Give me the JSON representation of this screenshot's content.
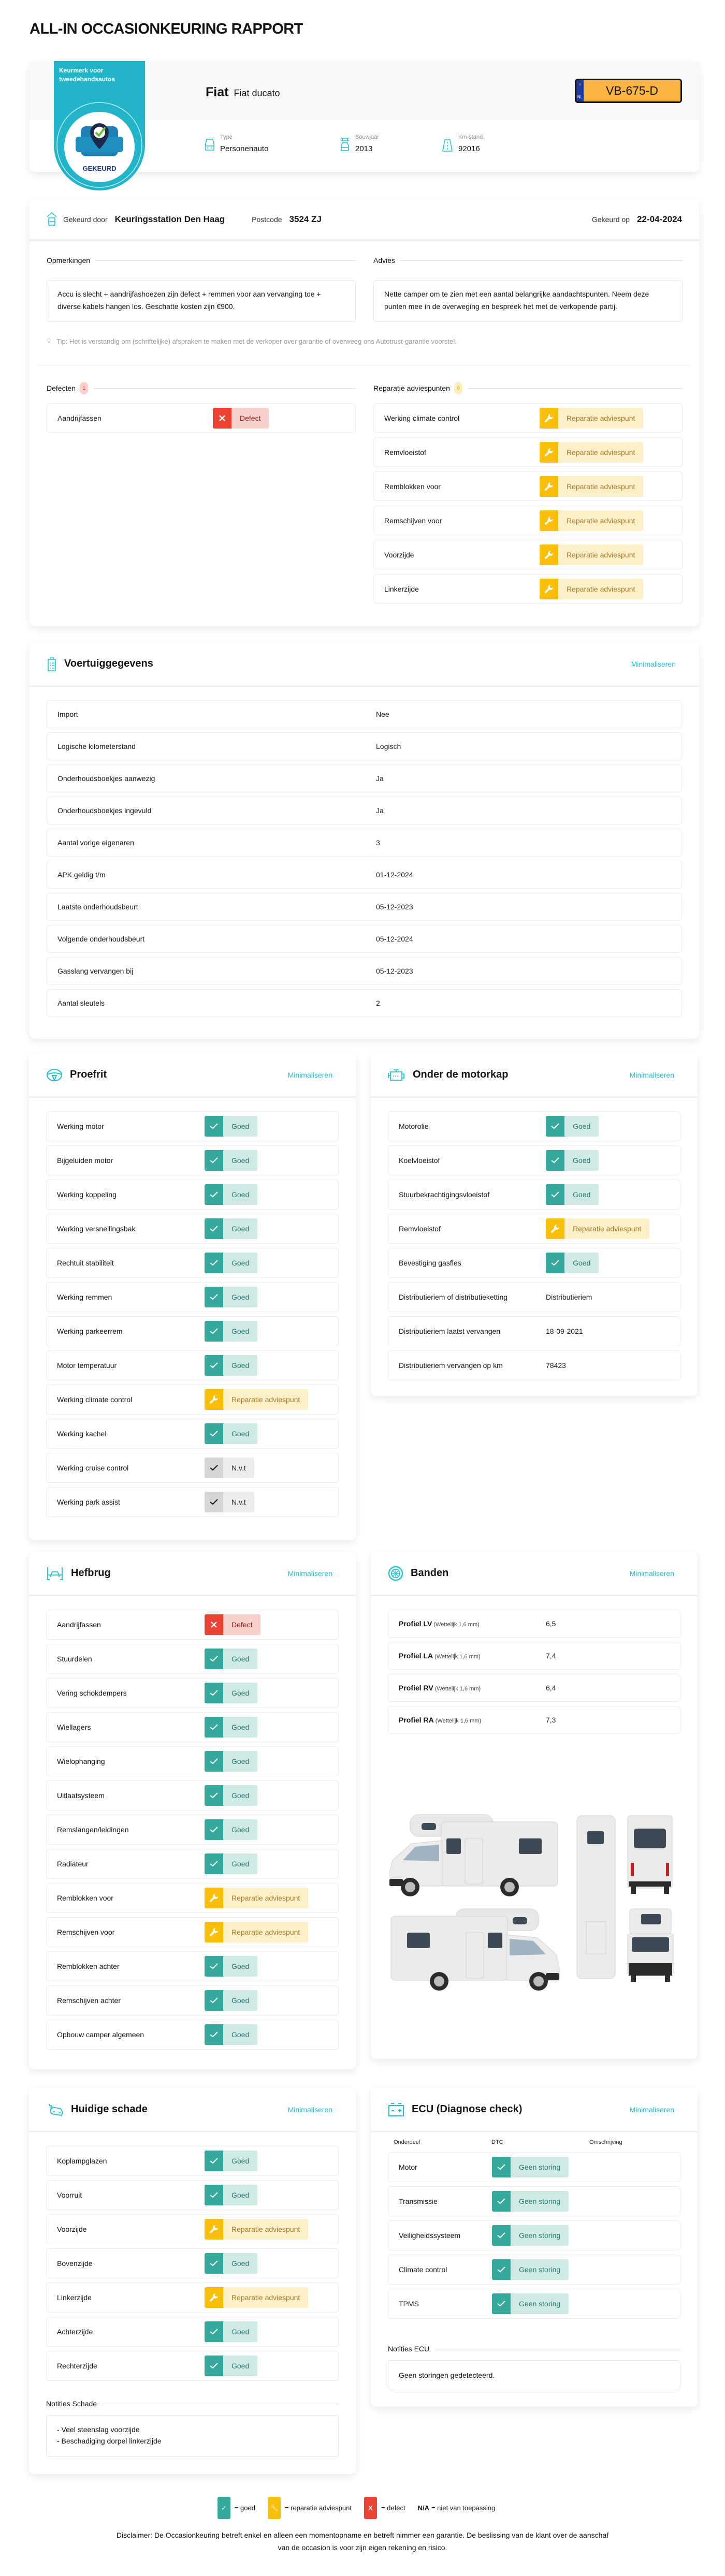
{
  "page_title": "ALL-IN OCCASIONKEURING RAPPORT",
  "colors": {
    "accent": "#1fc0d6",
    "goed": "#35a99b",
    "reparatie": "#f9bf0b",
    "defect": "#ea4335",
    "nvt": "#d6d6d6",
    "plate": "#fbb540"
  },
  "badge_logo": {
    "text_top": "Keurmerk voor tweedehandsautos",
    "text_bottom": "GEKEURD"
  },
  "vehicle_header": {
    "brand": "Fiat",
    "model": "Fiat ducato",
    "plate": {
      "country": "NL",
      "number": "VB-675-D"
    },
    "details": [
      {
        "label": "Type",
        "value": "Personenauto",
        "icon": "car-front-icon"
      },
      {
        "label": "Bouwjaar",
        "value": "2013",
        "icon": "car-lift-icon"
      },
      {
        "label": "Km-stand",
        "value": "92016",
        "icon": "road-icon"
      }
    ]
  },
  "inspection": {
    "by_label": "Gekeurd door",
    "by_value": "Keuringsstation Den Haag",
    "postcode_label": "Postcode",
    "postcode_value": "3524 ZJ",
    "date_label": "Gekeurd op",
    "date_value": "22-04-2024",
    "remarks_title": "Opmerkingen",
    "remarks": "Accu is slecht + aandrijfashoezen zijn defect + remmen voor aan vervanging toe + diverse kabels hangen los. Geschatte kosten zijn €900.",
    "advice_title": "Advies",
    "advice": "Nette camper om te zien met een aantal belangrijke aandachtspunten. Neem deze punten mee in de overweging en bespreek het met de verkopende partij.",
    "tip": "Tip: Het is verstandig om (schriftelijke) afspraken te maken met de verkoper over garantie of overweeg ons Autotrust-garantie voorstel.",
    "defects_title": "Defecten",
    "defects_count": "1",
    "defects": [
      {
        "label": "Aandrijfassen",
        "type": "def",
        "status": "Defect"
      }
    ],
    "repairs_title": "Reparatie adviespunten",
    "repairs_count": "6",
    "repairs": [
      {
        "label": "Werking climate control",
        "type": "rep",
        "status": "Reparatie adviespunt"
      },
      {
        "label": "Remvloeistof",
        "type": "rep",
        "status": "Reparatie adviespunt"
      },
      {
        "label": "Remblokken voor",
        "type": "rep",
        "status": "Reparatie adviespunt"
      },
      {
        "label": "Remschijven voor",
        "type": "rep",
        "status": "Reparatie adviespunt"
      },
      {
        "label": "Voorzijde",
        "type": "rep",
        "status": "Reparatie adviespunt"
      },
      {
        "label": "Linkerzijde",
        "type": "rep",
        "status": "Reparatie adviespunt"
      }
    ]
  },
  "minimize_label": "Minimaliseren",
  "vehicle_data": {
    "title": "Voertuiggegevens",
    "rows": [
      {
        "label": "Import",
        "value": "Nee"
      },
      {
        "label": "Logische kilometerstand",
        "value": "Logisch"
      },
      {
        "label": "Onderhoudsboekjes aanwezig",
        "value": "Ja"
      },
      {
        "label": "Onderhoudsboekjes ingevuld",
        "value": "Ja"
      },
      {
        "label": "Aantal vorige eigenaren",
        "value": "3"
      },
      {
        "label": "APK geldig t/m",
        "value": "01-12-2024"
      },
      {
        "label": "Laatste onderhoudsbeurt",
        "value": "05-12-2023"
      },
      {
        "label": "Volgende onderhoudsbeurt",
        "value": "05-12-2024"
      },
      {
        "label": "Gasslang vervangen bij",
        "value": "05-12-2023"
      },
      {
        "label": "Aantal sleutels",
        "value": "2"
      }
    ]
  },
  "proefrit": {
    "title": "Proefrit",
    "rows": [
      {
        "label": "Werking motor",
        "type": "goed",
        "status": "Goed"
      },
      {
        "label": "Bijgeluiden motor",
        "type": "goed",
        "status": "Goed"
      },
      {
        "label": "Werking koppeling",
        "type": "goed",
        "status": "Goed"
      },
      {
        "label": "Werking versnellingsbak",
        "type": "goed",
        "status": "Goed"
      },
      {
        "label": "Rechtuit stabiliteit",
        "type": "goed",
        "status": "Goed"
      },
      {
        "label": "Werking remmen",
        "type": "goed",
        "status": "Goed"
      },
      {
        "label": "Werking parkeerrem",
        "type": "goed",
        "status": "Goed"
      },
      {
        "label": "Motor temperatuur",
        "type": "goed",
        "status": "Goed"
      },
      {
        "label": "Werking climate control",
        "type": "rep",
        "status": "Reparatie adviespunt"
      },
      {
        "label": "Werking kachel",
        "type": "goed",
        "status": "Goed"
      },
      {
        "label": "Werking cruise control",
        "type": "nvt",
        "status": "N.v.t"
      },
      {
        "label": "Werking park assist",
        "type": "nvt",
        "status": "N.v.t"
      }
    ]
  },
  "motorkap": {
    "title": "Onder de motorkap",
    "rows": [
      {
        "label": "Motorolie",
        "type": "goed",
        "status": "Goed"
      },
      {
        "label": "Koelvloeistof",
        "type": "goed",
        "status": "Goed"
      },
      {
        "label": "Stuurbekrachtigingsvloeistof",
        "type": "goed",
        "status": "Goed"
      },
      {
        "label": "Remvloeistof",
        "type": "rep",
        "status": "Reparatie adviespunt"
      },
      {
        "label": "Bevestiging gasfles",
        "type": "goed",
        "status": "Goed"
      },
      {
        "label": "Distributieriem of distributieketting",
        "value": "Distributieriem"
      },
      {
        "label": "Distributieriem laatst vervangen",
        "value": "18-09-2021"
      },
      {
        "label": "Distributieriem vervangen op km",
        "value": "78423"
      }
    ]
  },
  "hefbrug": {
    "title": "Hefbrug",
    "rows": [
      {
        "label": "Aandrijfassen",
        "type": "def",
        "status": "Defect"
      },
      {
        "label": "Stuurdelen",
        "type": "goed",
        "status": "Goed"
      },
      {
        "label": "Vering schokdempers",
        "type": "goed",
        "status": "Goed"
      },
      {
        "label": "Wiellagers",
        "type": "goed",
        "status": "Goed"
      },
      {
        "label": "Wielophanging",
        "type": "goed",
        "status": "Goed"
      },
      {
        "label": "Uitlaatsysteem",
        "type": "goed",
        "status": "Goed"
      },
      {
        "label": "Remslangen/leidingen",
        "type": "goed",
        "status": "Goed"
      },
      {
        "label": "Radiateur",
        "type": "goed",
        "status": "Goed"
      },
      {
        "label": "Remblokken voor",
        "type": "rep",
        "status": "Reparatie adviespunt"
      },
      {
        "label": "Remschijven voor",
        "type": "rep",
        "status": "Reparatie adviespunt"
      },
      {
        "label": "Remblokken achter",
        "type": "goed",
        "status": "Goed"
      },
      {
        "label": "Remschijven achter",
        "type": "goed",
        "status": "Goed"
      },
      {
        "label": "Opbouw camper algemeen",
        "type": "goed",
        "status": "Goed"
      }
    ]
  },
  "banden": {
    "title": "Banden",
    "rows": [
      {
        "label": "Profiel LV",
        "note": "(Wettelijk 1,6 mm)",
        "value": "6,5"
      },
      {
        "label": "Profiel LA",
        "note": "(Wettelijk 1,6 mm)",
        "value": "7,4"
      },
      {
        "label": "Profiel RV",
        "note": "(Wettelijk 1,6 mm)",
        "value": "6,4"
      },
      {
        "label": "Profiel RA",
        "note": "(Wettelijk 1,6 mm)",
        "value": "7,3"
      }
    ]
  },
  "schade": {
    "title": "Huidige schade",
    "rows": [
      {
        "label": "Koplampglazen",
        "type": "goed",
        "status": "Goed"
      },
      {
        "label": "Voorruit",
        "type": "goed",
        "status": "Goed"
      },
      {
        "label": "Voorzijde",
        "type": "rep",
        "status": "Reparatie adviespunt"
      },
      {
        "label": "Bovenzijde",
        "type": "goed",
        "status": "Goed"
      },
      {
        "label": "Linkerzijde",
        "type": "rep",
        "status": "Reparatie adviespunt"
      },
      {
        "label": "Achterzijde",
        "type": "goed",
        "status": "Goed"
      },
      {
        "label": "Rechterzijde",
        "type": "goed",
        "status": "Goed"
      }
    ],
    "notes_title": "Notities Schade",
    "notes": [
      "- Veel steenslag voorzijde",
      "- Beschadiging dorpel linkerzijde"
    ]
  },
  "ecu": {
    "title": "ECU (Diagnose check)",
    "columns": [
      "Onderdeel",
      "DTC",
      "Omschrijving"
    ],
    "rows": [
      {
        "label": "Motor",
        "type": "goed",
        "status": "Geen storing"
      },
      {
        "label": "Transmissie",
        "type": "goed",
        "status": "Geen storing"
      },
      {
        "label": "Veiligheidssysteem",
        "type": "goed",
        "status": "Geen storing"
      },
      {
        "label": "Climate control",
        "type": "goed",
        "status": "Geen storing"
      },
      {
        "label": "TPMS",
        "type": "goed",
        "status": "Geen storing"
      }
    ],
    "notes_title": "Notities ECU",
    "notes": "Geen storingen gedetecteerd."
  },
  "legend": {
    "goed": "= goed",
    "reparatie": "= reparatie adviespunt",
    "defect": "= defect",
    "na_key": "N/A",
    "na": "= niet van toepassing"
  },
  "disclaimer": "Disclaimer: De Occasionkeuring betreft enkel en alleen een momentopname en betreft nimmer een garantie. De beslissing van de klant over de aanschaf van de occasion is voor zijn eigen rekening en risico."
}
